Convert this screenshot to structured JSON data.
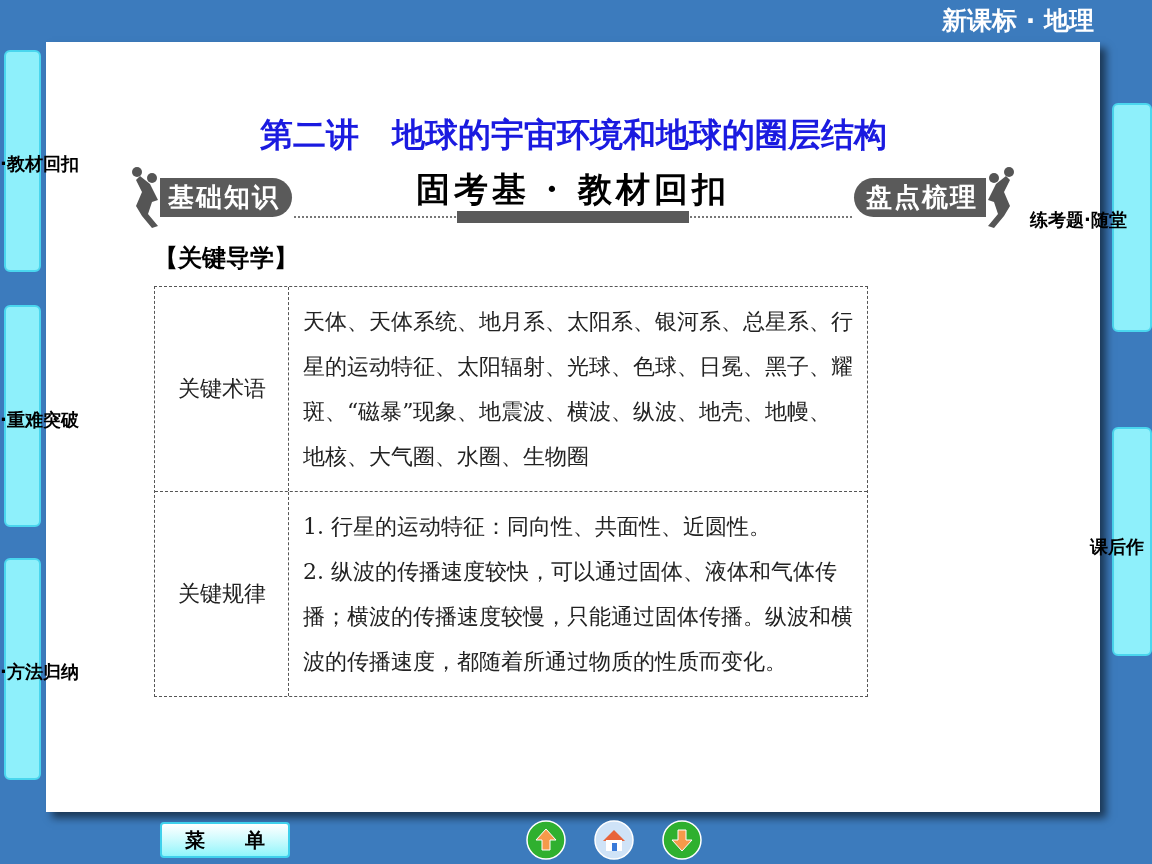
{
  "header": {
    "title": "新课标 · 地理"
  },
  "side_tabs": {
    "left": [
      {
        "label": "·教材回扣"
      },
      {
        "label": "·重难突破"
      },
      {
        "label": "·方法归纳"
      }
    ],
    "right": [
      {
        "label": "练考题·随堂"
      },
      {
        "label": "课后作"
      }
    ]
  },
  "slide": {
    "title": "第二讲　地球的宇宙环境和地球的圈层结构",
    "banner": {
      "heading": "固考基 · 教材回扣",
      "left_badge": "基础知识",
      "right_badge": "盘点梳理"
    },
    "section_label": "【关键导学】",
    "table": {
      "rows": [
        {
          "label": "关键术语",
          "lines": [
            "天体、天体系统、地月系、太阳系、银河系、总星系、行星的运动特征、太阳辐射、光球、色球、日冕、黑子、耀斑、“磁暴”现象、地震波、横波、纵波、地壳、地幔、地核、大气圈、水圈、生物圈"
          ]
        },
        {
          "label": "关键规律",
          "lines": [
            "1. 行星的运动特征：同向性、共面性、近圆性。",
            "2. 纵波的传播速度较快，可以通过固体、液体和气体传播；横波的传播速度较慢，只能通过固体传播。纵波和横波的传播速度，都随着所通过物质的性质而变化。"
          ]
        }
      ]
    }
  },
  "footer": {
    "menu_button": "菜　　单",
    "nav_buttons": [
      {
        "kind": "up"
      },
      {
        "kind": "home"
      },
      {
        "kind": "down"
      }
    ]
  }
}
